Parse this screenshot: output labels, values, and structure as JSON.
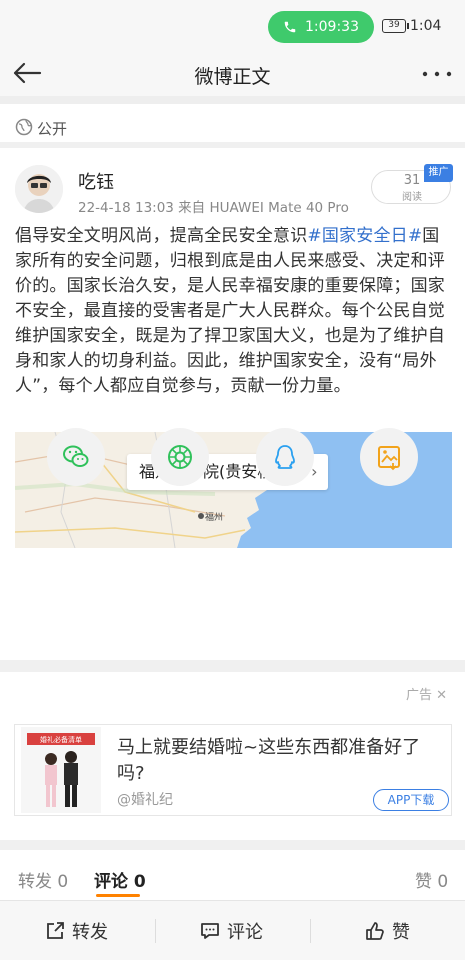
{
  "status_bar": {
    "call_timer": "1:09:33",
    "battery": "39",
    "time": "1:04"
  },
  "nav": {
    "title": "微博正文"
  },
  "visibility": {
    "label": "公开"
  },
  "post": {
    "username": "吃钰",
    "meta": "22-4-18 13:03  来自 HUAWEI Mate 40 Pro",
    "read_count": "31",
    "read_label": "阅读",
    "promo_tag": "推广",
    "text_before": "倡导安全文明风尚，提高全民安全意识",
    "topic": "#国家安全日#",
    "text_after": "国家所有的安全问题，归根到底是由人民来感受、决定和评价的。国家长治久安，是人民幸福安康的重要保障；国家不安全，最直接的受害者是广大人民群众。每个公民自觉维护国家安全，既是为了捍卫家国大义，也是为了维护自身和家人的切身利益。因此，维护国家安全，没有“局外人”，每个人都应自觉参与，贡献一份力量。",
    "location": "福建商学院(贵安校区)",
    "map_city": "福州"
  },
  "share_icons": [
    "wechat-icon",
    "moments-icon",
    "qq-icon",
    "save-image-icon"
  ],
  "ad": {
    "label": "广告",
    "close": "✕",
    "title": "马上就要结婚啦~这些东西都准备好了吗?",
    "source": "@婚礼纪",
    "button": "APP下载",
    "thumb_banner": "婚礼必备清单"
  },
  "tabs": {
    "repost": "转发 0",
    "comment": "评论 0",
    "like": "赞 0"
  },
  "toolbar": {
    "repost": "转发",
    "comment": "评论",
    "like": "赞"
  },
  "colors": {
    "accent": "#ff8200",
    "link": "#3370cc",
    "call_green": "#3fca6c",
    "brand_blue": "#3b7fe3"
  }
}
